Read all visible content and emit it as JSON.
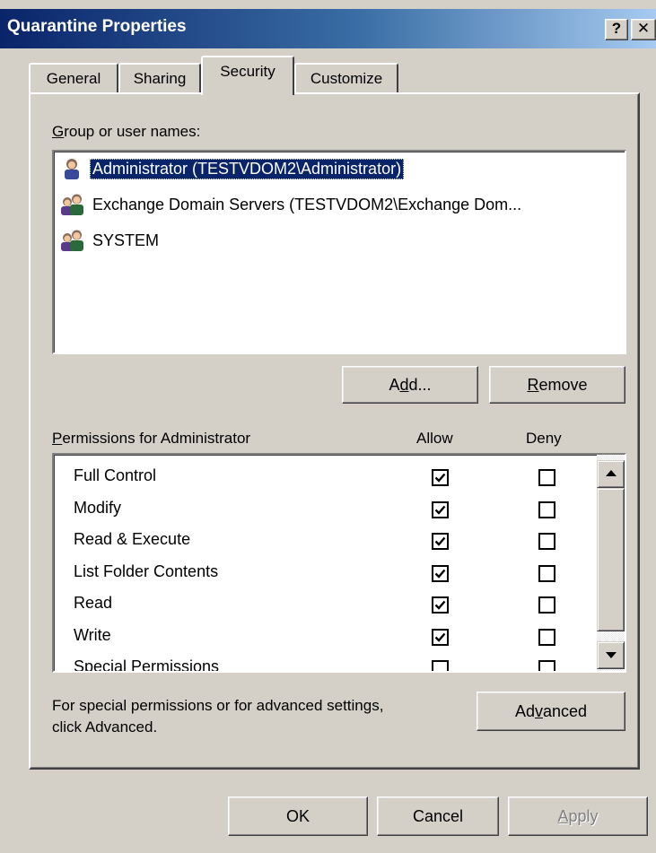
{
  "window": {
    "title": "Quarantine Properties",
    "help_glyph": "?",
    "close_glyph": "✕"
  },
  "tabs": [
    {
      "label": "General"
    },
    {
      "label": "Sharing"
    },
    {
      "label": "Security",
      "selected": true
    },
    {
      "label": "Customize"
    }
  ],
  "groups": {
    "label_mnemonic": "G",
    "label_rest": "roup or user names:",
    "items": [
      {
        "name": "Administrator (TESTVDOM2\\Administrator)",
        "icon": "user-icon",
        "selected": true
      },
      {
        "name": "Exchange Domain Servers (TESTVDOM2\\Exchange Dom...",
        "icon": "group-icon",
        "selected": false
      },
      {
        "name": "SYSTEM",
        "icon": "group-icon",
        "selected": false
      }
    ],
    "add_pre": "A",
    "add_mnemonic": "d",
    "add_post": "d...",
    "remove_mnemonic": "R",
    "remove_rest": "emove"
  },
  "permissions": {
    "label_mnemonic": "P",
    "label_rest": "ermissions for Administrator",
    "allow_header": "Allow",
    "deny_header": "Deny",
    "rows": [
      {
        "name": "Full Control",
        "allow": true,
        "deny": false
      },
      {
        "name": "Modify",
        "allow": true,
        "deny": false
      },
      {
        "name": "Read & Execute",
        "allow": true,
        "deny": false
      },
      {
        "name": "List Folder Contents",
        "allow": true,
        "deny": false
      },
      {
        "name": "Read",
        "allow": true,
        "deny": false
      },
      {
        "name": "Write",
        "allow": true,
        "deny": false
      },
      {
        "name": "Special Permissions",
        "allow": false,
        "deny": false
      }
    ]
  },
  "advanced": {
    "note_line1": "For special permissions or for advanced settings,",
    "note_line2": "click Advanced.",
    "button_pre": "Ad",
    "button_mnemonic": "v",
    "button_post": "anced"
  },
  "footer": {
    "ok": "OK",
    "cancel": "Cancel",
    "apply_mnemonic": "A",
    "apply_rest": "pply"
  }
}
